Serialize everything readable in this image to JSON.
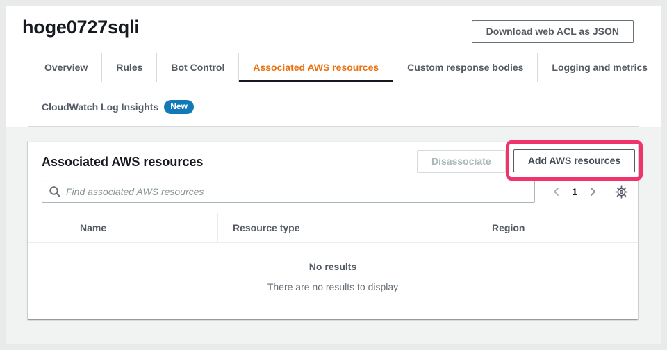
{
  "page": {
    "title": "hoge0727sqli",
    "download_button": "Download web ACL as JSON"
  },
  "tabs": [
    {
      "label": "Overview",
      "active": false
    },
    {
      "label": "Rules",
      "active": false
    },
    {
      "label": "Bot Control",
      "active": false
    },
    {
      "label": "Associated AWS resources",
      "active": true
    },
    {
      "label": "Custom response bodies",
      "active": false
    },
    {
      "label": "Logging and metrics",
      "active": false
    }
  ],
  "subnav": {
    "cloudwatch_label": "CloudWatch Log Insights",
    "new_badge": "New"
  },
  "panel": {
    "title": "Associated AWS resources",
    "disassociate_button": "Disassociate",
    "add_button": "Add AWS resources",
    "search_placeholder": "Find associated AWS resources",
    "pagination": {
      "current_page": "1"
    },
    "table": {
      "columns": [
        "Name",
        "Resource type",
        "Region"
      ],
      "rows": []
    },
    "empty_state": {
      "title": "No results",
      "description": "There are no results to display"
    }
  },
  "icons": {
    "search": "search-icon",
    "gear": "settings-gear-icon",
    "prev": "chevron-left-icon",
    "next": "chevron-right-icon"
  },
  "colors": {
    "accent_orange": "#ec7211",
    "badge_blue": "#1279b8",
    "annotation_pink": "#f0346b",
    "text_dark": "#16191f",
    "text_secondary": "#545b64"
  }
}
